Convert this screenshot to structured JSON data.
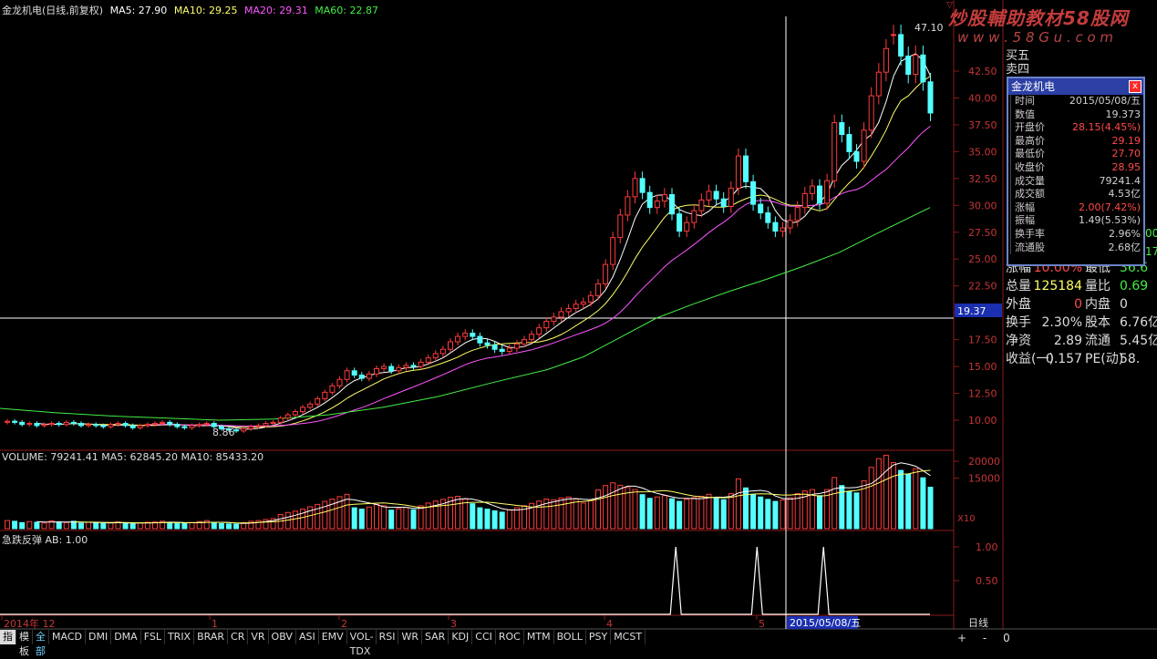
{
  "header": {
    "title": "金龙机电(日线,前复权)",
    "ma5": "MA5: 27.90",
    "ma10": "MA10: 29.25",
    "ma20": "MA20: 29.31",
    "ma60": "MA60: 22.87"
  },
  "watermark": {
    "line1": "炒股輔助教材58股网",
    "line2": "w w w . 5 8 G u . c o m"
  },
  "price_panel": {
    "axis_labels": [
      "42.50",
      "40.00",
      "37.50",
      "35.00",
      "32.50",
      "30.00",
      "27.50",
      "25.00",
      "22.50",
      "20.00",
      "17.50",
      "15.00",
      "12.50",
      "10.00"
    ],
    "crosshair_value": "19.37",
    "high_marker": "47.10",
    "low_marker": "8.86"
  },
  "volume_panel": {
    "header": "VOLUME: 79241.41  MA5: 62845.20  MA10: 85433.20",
    "axis_labels": [
      "20000",
      "15000"
    ],
    "unit_label": "X10"
  },
  "indicator_panel": {
    "header": "急跌反弹  AB: 1.00",
    "axis_labels": [
      "1.00",
      "0.50"
    ]
  },
  "date_axis": {
    "labels": [
      "2014年 12",
      "1",
      "2",
      "3",
      "4",
      "5"
    ],
    "crosshair_date": "2015/05/08/五",
    "period_label": "日线"
  },
  "popup": {
    "title": "金龙机电",
    "close_glyph": "x",
    "rows": [
      {
        "label": "时间",
        "value": "2015/05/08/五",
        "color": "#d0d0d0"
      },
      {
        "label": "数值",
        "value": "19.373",
        "color": "#d0d0d0"
      },
      {
        "label": "开盘价",
        "value": "28.15(4.45%)",
        "color": "#ff4a4a"
      },
      {
        "label": "最高价",
        "value": "29.19",
        "color": "#ff4a4a"
      },
      {
        "label": "最低价",
        "value": "27.70",
        "color": "#ff4a4a"
      },
      {
        "label": "收盘价",
        "value": "28.95",
        "color": "#ff4a4a"
      },
      {
        "label": "成交量",
        "value": "79241.4",
        "color": "#d0d0d0"
      },
      {
        "label": "成交额",
        "value": "4.53亿",
        "color": "#d0d0d0"
      },
      {
        "label": "涨幅",
        "value": "2.00(7.42%)",
        "color": "#ff4a4a"
      },
      {
        "label": "振幅",
        "value": "1.49(5.53%)",
        "color": "#d0d0d0"
      },
      {
        "label": "换手率",
        "value": "2.96%",
        "color": "#d0d0d0"
      },
      {
        "label": "流通股",
        "value": "2.68亿",
        "color": "#d0d0d0"
      }
    ]
  },
  "quote_panel": {
    "top_labels": [
      "买五",
      "卖四"
    ],
    "rows": [
      {
        "l1": "涨幅",
        "v1": "10.00%",
        "l2": "最低",
        "v2": "36.6"
      },
      {
        "l1": "总量",
        "v1": "125184",
        "l2": "量比",
        "v2": "0.69"
      },
      {
        "l1": "外盘",
        "v1": "0",
        "l2": "内盘",
        "v2": "0"
      },
      {
        "l1": "换手",
        "v1": "2.30%",
        "l2": "股本",
        "v2": "6.76亿"
      },
      {
        "l1": "净资",
        "v1": "2.89",
        "l2": "流通",
        "v2": "5.45亿"
      },
      {
        "l1": "收益(一)",
        "v1": "0.157",
        "l2": "PE(动)",
        "v2": "58."
      }
    ],
    "side_values": [
      "00",
      "17"
    ]
  },
  "tabs": [
    "指标",
    "模板",
    "全部",
    "MACD",
    "DMI",
    "DMA",
    "FSL",
    "TRIX",
    "BRAR",
    "CR",
    "VR",
    "OBV",
    "ASI",
    "EMV",
    "VOL-TDX",
    "RSI",
    "WR",
    "SAR",
    "KDJ",
    "CCI",
    "ROC",
    "MTM",
    "BOLL",
    "PSY",
    "MCST"
  ],
  "controls": [
    "+",
    "-",
    "0"
  ],
  "colors": {
    "up": "#ff3b3b",
    "down": "#54ffff",
    "ma5": "#ffffff",
    "ma10": "#ffff66",
    "ma20": "#ff55ff",
    "ma60": "#44ee44",
    "panel_border": "#8b1a1a"
  },
  "chart_data": {
    "type": "candlestick",
    "ylim": [
      8.0,
      47.1
    ],
    "volume_ylim": [
      0,
      23000
    ],
    "closes": [
      9.9,
      9.8,
      9.6,
      9.7,
      9.5,
      9.6,
      9.7,
      9.6,
      9.8,
      9.7,
      9.5,
      9.6,
      9.5,
      9.4,
      9.6,
      9.7,
      9.5,
      9.3,
      9.5,
      9.6,
      9.7,
      9.8,
      9.6,
      9.4,
      9.3,
      9.5,
      9.6,
      9.7,
      9.4,
      9.2,
      9.1,
      9.0,
      9.2,
      9.4,
      9.5,
      9.7,
      9.8,
      10.2,
      10.5,
      10.8,
      11.2,
      11.5,
      12.0,
      12.6,
      13.2,
      13.8,
      14.6,
      14.2,
      13.9,
      14.3,
      14.8,
      15.0,
      14.6,
      14.9,
      15.1,
      15.0,
      15.4,
      15.8,
      16.2,
      16.6,
      17.3,
      17.8,
      18.1,
      17.8,
      17.2,
      17.0,
      16.6,
      16.4,
      16.7,
      17.1,
      17.5,
      18.0,
      18.6,
      19.2,
      19.6,
      20.1,
      20.4,
      20.8,
      21.0,
      21.6,
      22.7,
      24.5,
      27.0,
      29.1,
      30.8,
      32.5,
      31.2,
      29.8,
      30.4,
      31.0,
      29.2,
      27.6,
      28.4,
      29.5,
      30.5,
      31.3,
      30.6,
      29.9,
      31.6,
      34.6,
      32.2,
      30.1,
      29.3,
      28.4,
      27.6,
      27.9,
      28.6,
      29.8,
      31.1,
      31.8,
      30.2,
      32.3,
      37.7,
      36.6,
      35.0,
      34.1,
      37.0,
      40.2,
      42.4,
      44.6,
      45.9,
      43.9,
      42.2,
      44.0,
      41.5,
      38.6
    ],
    "opens": [
      9.8,
      9.9,
      9.8,
      9.6,
      9.7,
      9.5,
      9.6,
      9.7,
      9.6,
      9.8,
      9.7,
      9.5,
      9.6,
      9.5,
      9.4,
      9.6,
      9.7,
      9.5,
      9.3,
      9.5,
      9.6,
      9.7,
      9.8,
      9.6,
      9.4,
      9.3,
      9.5,
      9.6,
      9.7,
      9.4,
      9.2,
      9.1,
      9.0,
      9.2,
      9.4,
      9.5,
      9.7,
      9.8,
      10.2,
      10.5,
      10.8,
      11.2,
      11.5,
      12.0,
      12.6,
      13.2,
      13.8,
      14.6,
      14.2,
      13.9,
      14.3,
      14.8,
      15.0,
      14.6,
      14.9,
      15.1,
      15.0,
      15.4,
      15.8,
      16.2,
      16.6,
      17.3,
      17.8,
      18.1,
      17.8,
      17.2,
      17.0,
      16.6,
      16.4,
      16.7,
      17.1,
      17.5,
      18.0,
      18.6,
      19.2,
      19.6,
      20.1,
      20.4,
      20.8,
      21.0,
      21.6,
      22.7,
      24.5,
      27.0,
      29.1,
      30.8,
      32.5,
      31.2,
      29.8,
      30.4,
      31.0,
      29.2,
      27.6,
      28.4,
      29.5,
      30.5,
      31.3,
      30.6,
      29.9,
      31.6,
      34.6,
      32.2,
      30.1,
      29.3,
      28.4,
      27.6,
      27.9,
      28.6,
      29.8,
      31.1,
      31.8,
      30.2,
      32.3,
      37.7,
      36.6,
      35.0,
      34.1,
      37.0,
      40.2,
      42.4,
      45.9,
      45.9,
      43.9,
      42.2,
      44.0,
      41.5
    ],
    "volumes": [
      2400,
      2200,
      1800,
      2100,
      1900,
      1700,
      2300,
      2000,
      1800,
      2200,
      1600,
      1900,
      1700,
      1500,
      1800,
      2000,
      1600,
      1400,
      1700,
      1900,
      2000,
      2200,
      1800,
      1600,
      1500,
      1800,
      2100,
      2400,
      1700,
      1500,
      1400,
      1300,
      1800,
      2200,
      2400,
      2700,
      3000,
      4200,
      4800,
      5200,
      5800,
      6500,
      7200,
      8100,
      8800,
      9500,
      10200,
      6200,
      5800,
      6400,
      7200,
      6800,
      5500,
      5900,
      6300,
      5600,
      6800,
      7600,
      8200,
      8700,
      9300,
      9600,
      8800,
      7400,
      6200,
      5800,
      5300,
      4900,
      5600,
      6200,
      6800,
      7500,
      8200,
      8800,
      8600,
      9100,
      9400,
      8800,
      7600,
      8300,
      11500,
      12800,
      13600,
      12900,
      12200,
      11600,
      10100,
      9000,
      9400,
      9800,
      8900,
      8100,
      8700,
      9200,
      9600,
      10200,
      9100,
      8600,
      10400,
      14800,
      12100,
      10100,
      9400,
      8700,
      8100,
      8500,
      9200,
      10400,
      11200,
      11600,
      9800,
      11600,
      15200,
      12800,
      11100,
      10600,
      14200,
      18200,
      20800,
      21800,
      19600,
      17300,
      16200,
      17800,
      15100,
      12300
    ],
    "ma60_points": [
      [
        0,
        11.1
      ],
      [
        60,
        10.7
      ],
      [
        120,
        10.4
      ],
      [
        180,
        10.2
      ],
      [
        240,
        10.0
      ],
      [
        300,
        10.1
      ],
      [
        360,
        10.5
      ],
      [
        420,
        11.2
      ],
      [
        480,
        12.2
      ],
      [
        540,
        13.5
      ],
      [
        600,
        14.7
      ],
      [
        640,
        15.9
      ],
      [
        680,
        17.7
      ],
      [
        720,
        19.5
      ],
      [
        760,
        20.8
      ],
      [
        800,
        22.0
      ],
      [
        840,
        23.1
      ],
      [
        880,
        24.3
      ],
      [
        920,
        25.6
      ],
      [
        960,
        27.3
      ],
      [
        1020,
        29.8
      ]
    ],
    "signal_dates_index": [
      92,
      103,
      112
    ]
  }
}
